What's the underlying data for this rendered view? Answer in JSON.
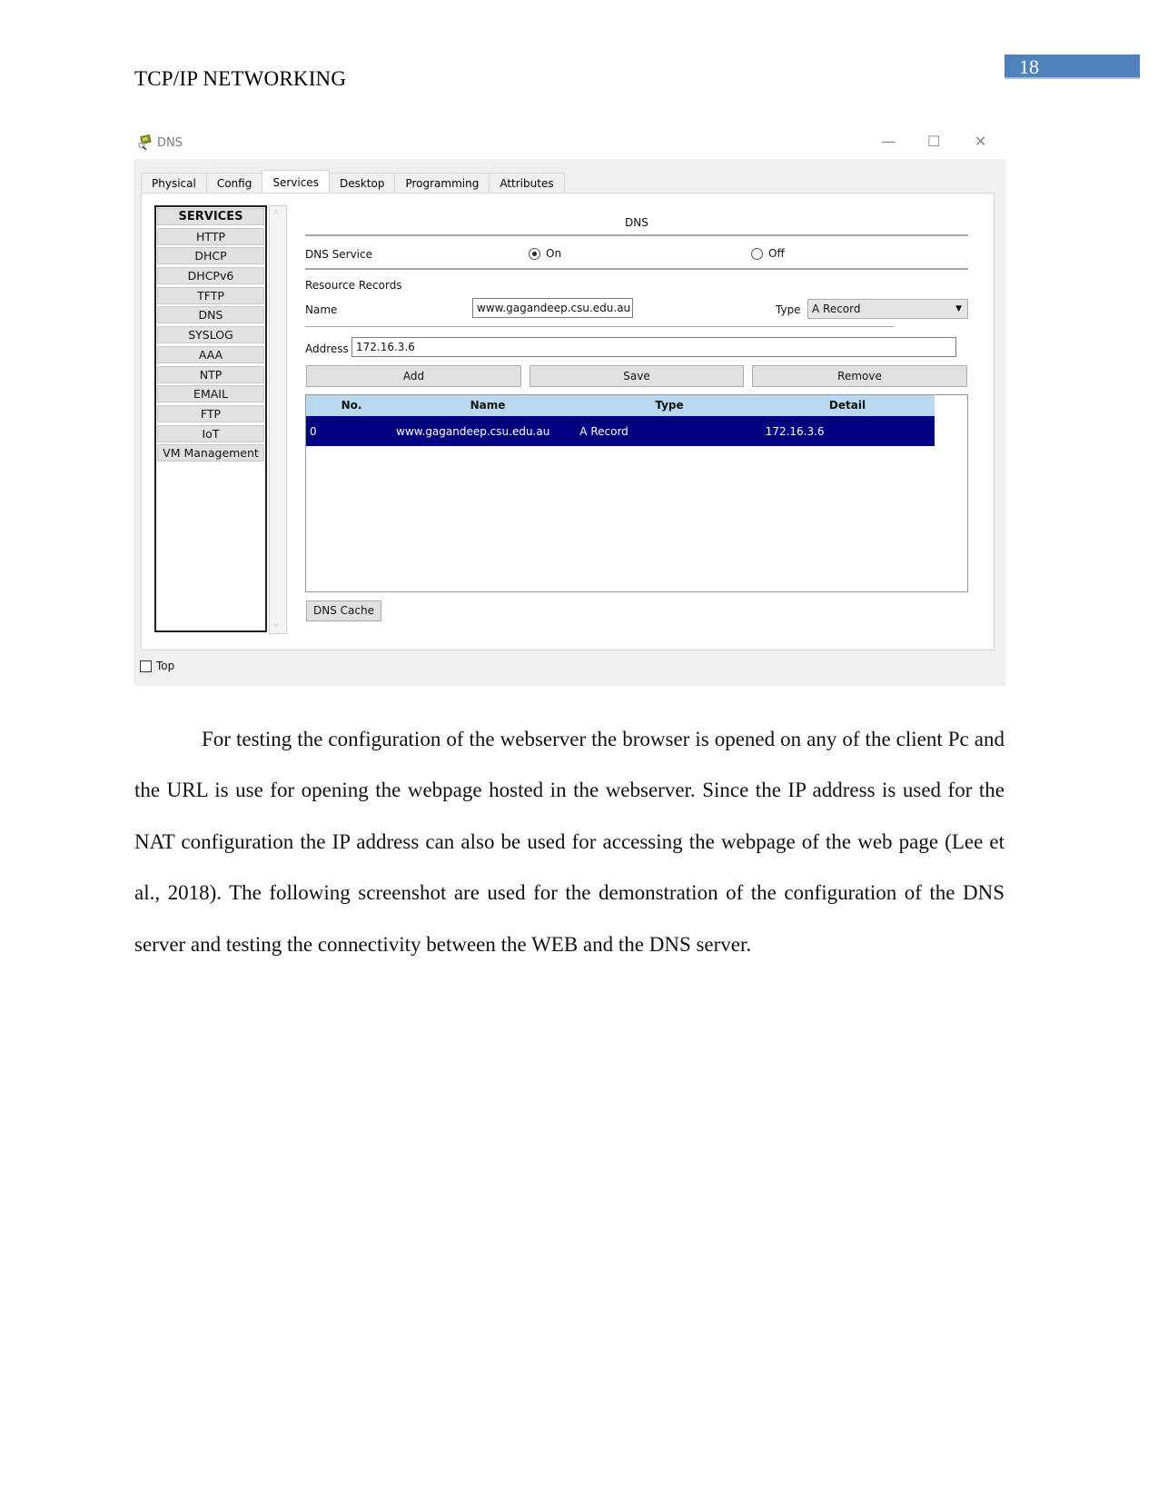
{
  "document": {
    "running_header": "TCP/IP NETWORKING",
    "page_number": "18",
    "page_number_color": "#4f81bd"
  },
  "window": {
    "title": "DNS",
    "icon": "packet-tracer-server-icon",
    "controls": {
      "minimize": "—",
      "maximize": "☐",
      "close": "✕"
    },
    "tabs": [
      {
        "label": "Physical",
        "active": false
      },
      {
        "label": "Config",
        "active": false
      },
      {
        "label": "Services",
        "active": true
      },
      {
        "label": "Desktop",
        "active": false
      },
      {
        "label": "Programming",
        "active": false
      },
      {
        "label": "Attributes",
        "active": false
      }
    ],
    "services": {
      "header": "SERVICES",
      "items": [
        "HTTP",
        "DHCP",
        "DHCPv6",
        "TFTP",
        "DNS",
        "SYSLOG",
        "AAA",
        "NTP",
        "EMAIL",
        "FTP",
        "IoT",
        "VM Management"
      ],
      "selected": "DNS"
    },
    "dns": {
      "section_title": "DNS",
      "service_label": "DNS Service",
      "on_label": "On",
      "off_label": "Off",
      "service_state": "On",
      "resource_records_label": "Resource Records",
      "name_label": "Name",
      "name_value": "www.gagandeep.csu.edu.au",
      "type_label": "Type",
      "type_value": "A Record",
      "address_label": "Address",
      "address_value": "172.16.3.6",
      "buttons": {
        "add": "Add",
        "save": "Save",
        "remove": "Remove",
        "dns_cache": "DNS Cache"
      },
      "table": {
        "columns": [
          "No.",
          "Name",
          "Type",
          "Detail"
        ],
        "rows": [
          {
            "no": "0",
            "name": "www.gagandeep.csu.edu.au",
            "type": "A Record",
            "detail": "172.16.3.6",
            "selected": true
          }
        ],
        "header_color": "#b9d9f1",
        "selected_row_color": "#000080"
      }
    },
    "top_checkbox": {
      "label": "Top",
      "checked": false
    }
  },
  "body_text": {
    "paragraph": "For testing the configuration of the webserver the browser is opened on any of the client Pc and the URL is use for opening the webpage hosted in the webserver. Since the IP address is used for the NAT configuration the IP address can also be used for accessing the webpage of the web page (Lee et al., 2018). The following screenshot are used for the demonstration of the configuration of the DNS server and testing the connectivity between the WEB and the DNS server."
  }
}
